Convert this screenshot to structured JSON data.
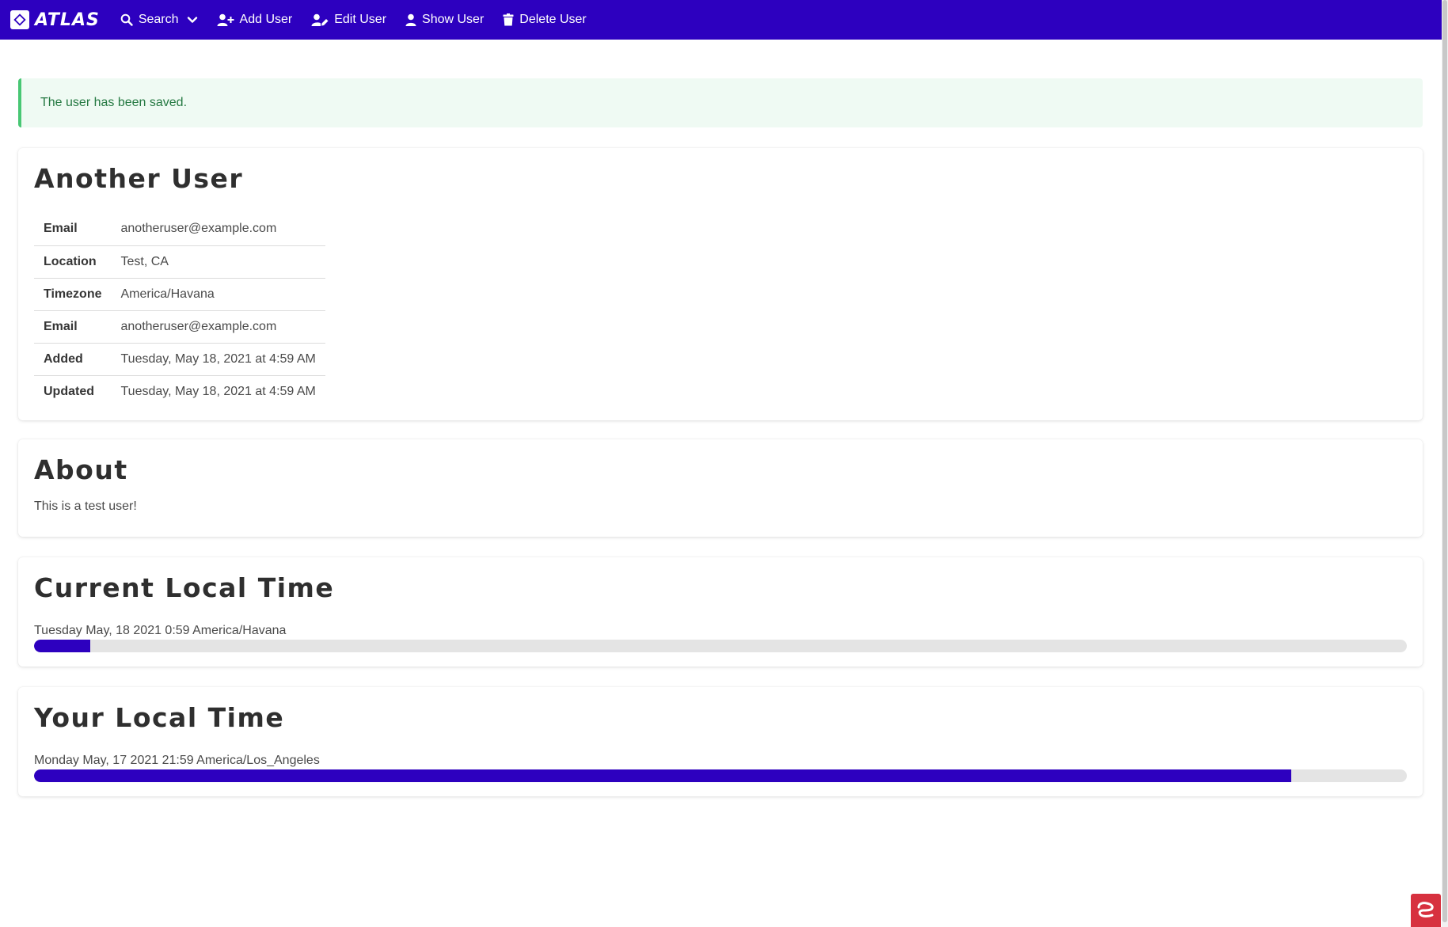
{
  "navbar": {
    "brand": "ATLAS",
    "items": [
      {
        "label": "Search",
        "icon": "search-icon"
      },
      {
        "label": "Add User",
        "icon": "user-plus-icon"
      },
      {
        "label": "Edit User",
        "icon": "user-edit-icon"
      },
      {
        "label": "Show User",
        "icon": "user-icon"
      },
      {
        "label": "Delete User",
        "icon": "trash-icon"
      }
    ]
  },
  "alert": {
    "message": "The user has been saved."
  },
  "user": {
    "name": "Another User",
    "fields": [
      {
        "label": "Email",
        "value": "anotheruser@example.com"
      },
      {
        "label": "Location",
        "value": "Test, CA"
      },
      {
        "label": "Timezone",
        "value": "America/Havana"
      },
      {
        "label": "Email",
        "value": "anotheruser@example.com"
      },
      {
        "label": "Added",
        "value": "Tuesday, May 18, 2021 at 4:59 AM"
      },
      {
        "label": "Updated",
        "value": "Tuesday, May 18, 2021 at 4:59 AM"
      }
    ]
  },
  "about": {
    "title": "About",
    "text": "This is a test user!"
  },
  "current_local_time": {
    "title": "Current Local Time",
    "label": "Tuesday May, 18 2021 0:59 America/Havana",
    "progress_fraction": 0.041
  },
  "your_local_time": {
    "title": "Your Local Time",
    "label": "Monday May, 17 2021 21:59 America/Los_Angeles",
    "progress_fraction": 0.916
  },
  "colors": {
    "navbar": "#2d00bf",
    "progress_fill": "#2d00bf",
    "alert_bg": "#effaf3",
    "alert_border": "#48c774",
    "alert_text": "#257942",
    "corner_widget": "#d7313f"
  }
}
